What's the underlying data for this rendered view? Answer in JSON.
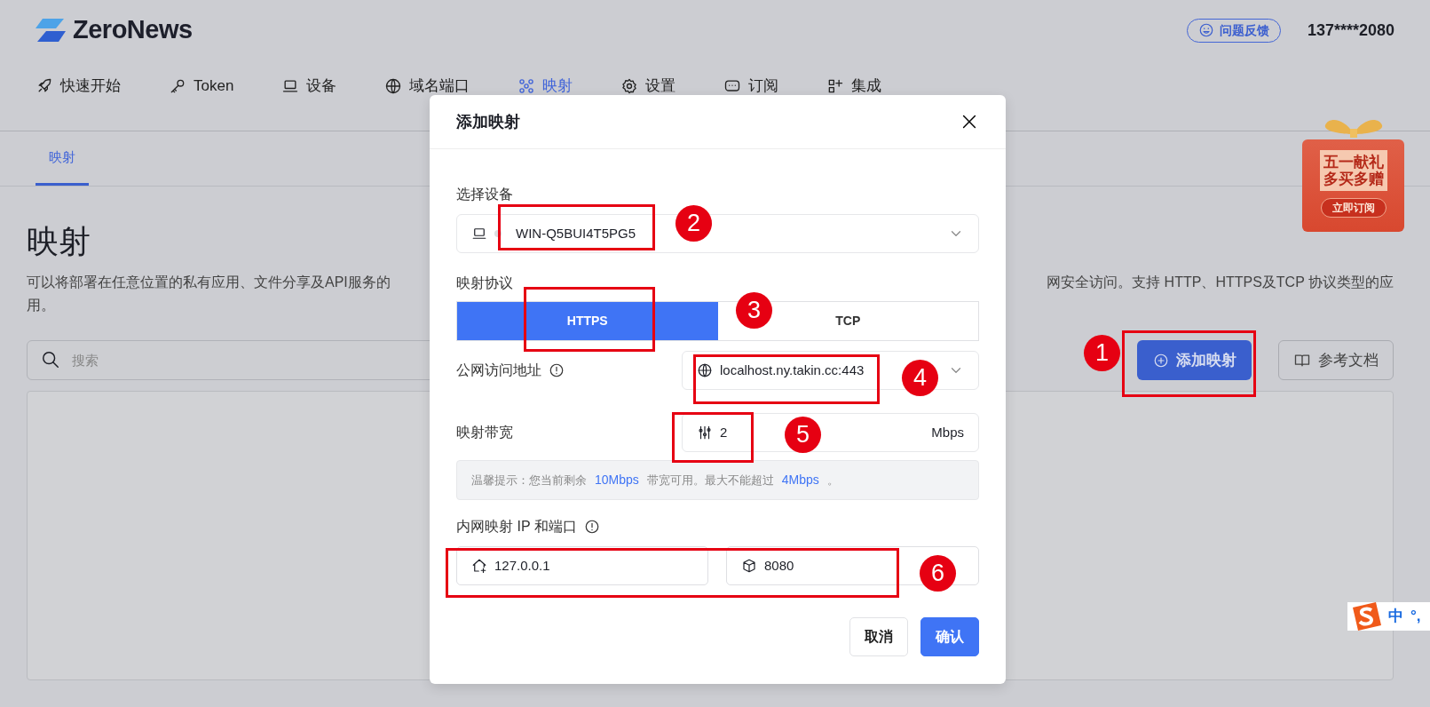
{
  "header": {
    "logo": "ZeroNews",
    "feedback_button": "问题反馈",
    "user": "137****2080"
  },
  "nav": [
    {
      "label": "快速开始",
      "selected": false
    },
    {
      "label": "Token",
      "selected": false
    },
    {
      "label": "设备",
      "selected": false
    },
    {
      "label": "域名端口",
      "selected": false
    },
    {
      "label": "映射",
      "selected": true
    },
    {
      "label": "设置",
      "selected": false
    },
    {
      "label": "订阅",
      "selected": false
    },
    {
      "label": "集成",
      "selected": false
    }
  ],
  "subtabs": [
    {
      "label": "映射",
      "selected": true
    }
  ],
  "page": {
    "title": "映射",
    "description_left": "可以将部署在任意位置的私有应用、文件分享及API服务的",
    "description_right": "网安全访问。支持 HTTP、HTTPS及TCP 协议类型的应",
    "description_end": "用。",
    "search": {
      "placeholder": "搜索"
    },
    "add_button": "添加映射",
    "docs_button": "参考文档"
  },
  "promo": {
    "lines": [
      "五一献礼",
      "多买多赠"
    ],
    "button": "立即订阅"
  },
  "modal": {
    "title": "添加映射",
    "device": {
      "label": "选择设备",
      "value": "WIN-Q5BUI4T5PG5"
    },
    "protocol": {
      "label": "映射协议",
      "options": [
        {
          "label": "HTTPS",
          "selected": true
        },
        {
          "label": "TCP",
          "selected": false
        }
      ]
    },
    "public_address": {
      "label": "公网访问地址",
      "value": "localhost.ny.takin.cc:443"
    },
    "bandwidth": {
      "label": "映射带宽",
      "value": "2",
      "unit": "Mbps"
    },
    "hint": [
      {
        "text": "温馨提示：您当前剩余",
        "kind": "text"
      },
      {
        "text": "10Mbps",
        "kind": "value"
      },
      {
        "text": "带宽可用。最大不能超过",
        "kind": "text"
      },
      {
        "text": "4Mbps",
        "kind": "value"
      },
      {
        "text": "。",
        "kind": "text"
      }
    ],
    "internal": {
      "label": "内网映射 IP 和端口",
      "ip": "127.0.0.1",
      "port": "8080"
    },
    "buttons": [
      {
        "label": "取消",
        "kind": "secondary"
      },
      {
        "label": "确认",
        "kind": "primary"
      }
    ]
  },
  "annotations": [
    {
      "number": "1"
    },
    {
      "number": "2"
    },
    {
      "number": "3"
    },
    {
      "number": "4"
    },
    {
      "number": "5"
    },
    {
      "number": "6"
    }
  ],
  "ime": {
    "mode": "中",
    "punctuation": "°,"
  }
}
